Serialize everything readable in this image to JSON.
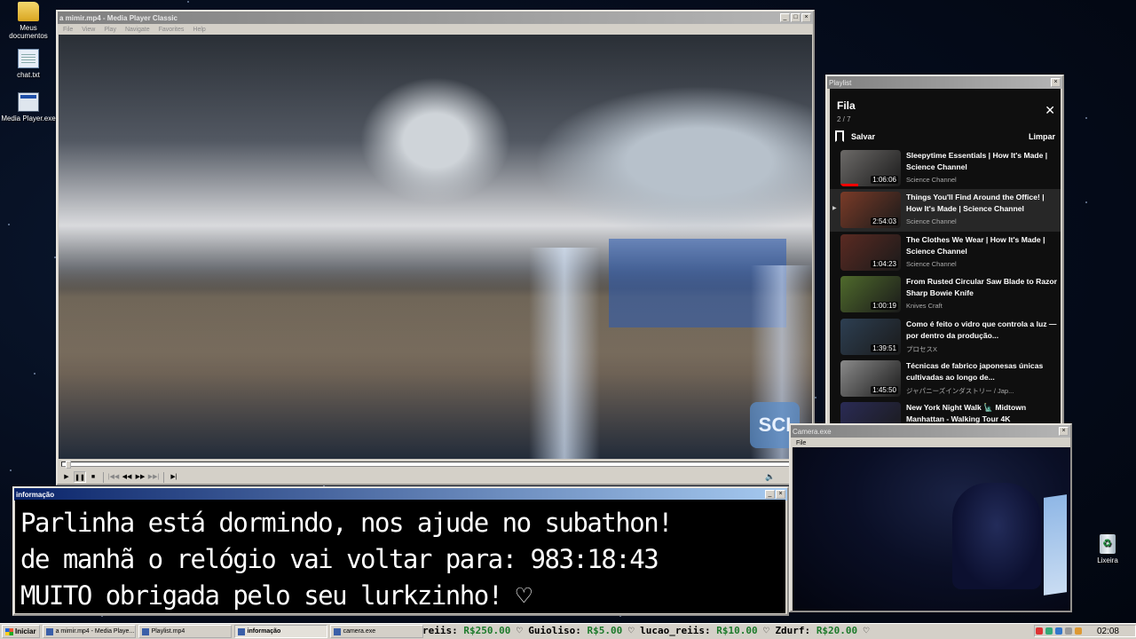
{
  "desktop": {
    "icons": [
      {
        "label": "Meus documentos"
      },
      {
        "label": "chat.txt"
      },
      {
        "label": "Media Player.exe"
      },
      {
        "label": "Lixeira"
      }
    ]
  },
  "player": {
    "title": "a mimir.mp4 - Media Player Classic",
    "menu": [
      "File",
      "View",
      "Play",
      "Navigate",
      "Favorites",
      "Help"
    ],
    "watermark": "SCI",
    "progress": 0.005
  },
  "playlist": {
    "window_title": "Playlist",
    "title": "Fila",
    "count": "2 / 7",
    "save_label": "Salvar",
    "clear_label": "Limpar",
    "items": [
      {
        "title": "Sleepytime Essentials | How It's Made | Science Channel",
        "channel": "Science Channel",
        "duration": "1:06:06",
        "thumb_color": "#6c6a68",
        "watched": 0.3
      },
      {
        "title": "Things You'll Find Around the Office! | How It's Made | Science Channel",
        "channel": "Science Channel",
        "duration": "2:54:03",
        "thumb_color": "#7a3b28",
        "current": true
      },
      {
        "title": "The Clothes We Wear | How It's Made | Science Channel",
        "channel": "Science Channel",
        "duration": "1:04:23",
        "thumb_color": "#5a2a22"
      },
      {
        "title": "From Rusted Circular Saw Blade to Razor Sharp Bowie Knife",
        "channel": "Knives Craft",
        "duration": "1:00:19",
        "thumb_color": "#4f6a2c"
      },
      {
        "title": "Como é feito o vidro que controla a luz — por dentro da produção...",
        "channel": "プロセスX",
        "duration": "1:39:51",
        "thumb_color": "#2d3f52"
      },
      {
        "title": "Técnicas de fabrico japonesas únicas cultivadas ao longo de...",
        "channel": "ジャパニーズインダストリー / Jap...",
        "duration": "1:45:50",
        "thumb_color": "#8a8a8a"
      },
      {
        "title": "New York Night Walk 🗽 Midtown Manhattan - Walking Tour 4K",
        "channel": "",
        "duration": "",
        "thumb_color": "#2a2b55"
      }
    ]
  },
  "info": {
    "title": "informação",
    "lines": [
      "Parlinha está dormindo, nos ajude no subathon!",
      "de manhã o relógio vai voltar para:  983:18:43",
      "MUITO obrigada pelo seu lurkzinho! ♡"
    ]
  },
  "camera": {
    "title": "Camera.exe",
    "menu": [
      "File"
    ]
  },
  "taskbar": {
    "start_label": "Iniciar",
    "tasks": [
      {
        "label": "a mimir.mp4 - Media Playe...",
        "pressed": false
      },
      {
        "label": "Playlist.mp4",
        "pressed": false
      },
      {
        "label": "informação",
        "pressed": true
      },
      {
        "label": "camera.exe",
        "pressed": false
      }
    ],
    "ticker": [
      {
        "name": "reiis:",
        "amount": "R$250.00"
      },
      {
        "name": "Guioliso:",
        "amount": "R$5.00"
      },
      {
        "name": "lucao_reiis:",
        "amount": "R$10.00"
      },
      {
        "name": "Zdurf:",
        "amount": "R$20.00"
      }
    ],
    "clock": "02:08"
  }
}
